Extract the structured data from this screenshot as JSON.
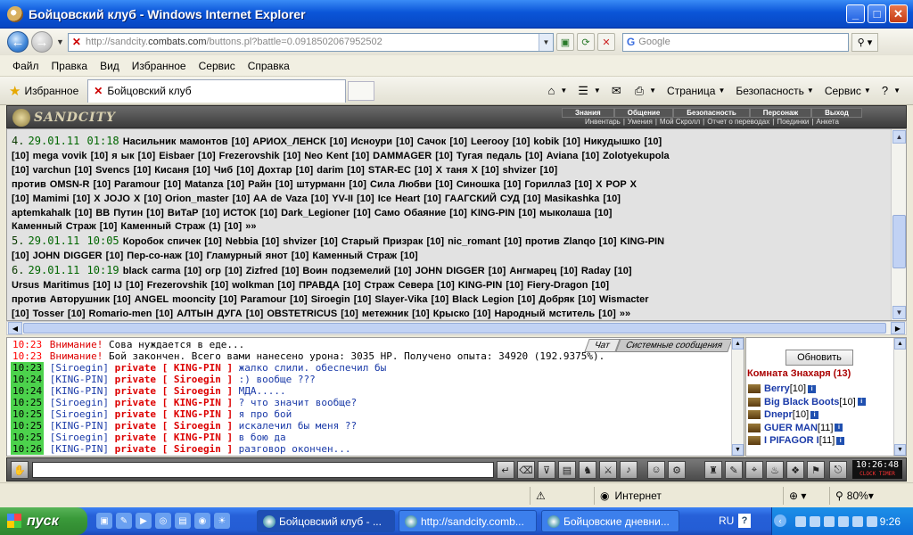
{
  "window": {
    "title": "Бойцовский клуб - Windows Internet Explorer"
  },
  "address": {
    "url_prefix": "http://sandcity.",
    "url_domain": "combats.com",
    "url_path": "/buttons.pl?battle=0.0918502067952502",
    "search_placeholder": "Google"
  },
  "menu": [
    "Файл",
    "Правка",
    "Вид",
    "Избранное",
    "Сервис",
    "Справка"
  ],
  "favbar": {
    "favorites": "Избранное",
    "tab_title": "Бойцовский клуб",
    "page": "Страница",
    "security": "Безопасность",
    "service": "Сервис"
  },
  "game": {
    "logo": "SANDCITY",
    "nav": [
      "Знания",
      "Общение",
      "Безопасность",
      "Персонаж",
      "Выход"
    ],
    "subnav": [
      "Инвентарь",
      "|",
      "Умения",
      "|",
      "Мой Скролл",
      "|",
      "Отчет о переводах",
      "|",
      "Поединки",
      "|",
      "Анкета"
    ]
  },
  "log": {
    "lines": [
      {
        "num": "4.",
        "date": "29.01.11 01:18",
        "text": "Насильник мамонтов [10] АРИОХ_ЛЕНСК [10] Исноури [10] Сачок [10] Leerooy [10] kobik [10] Никудышко [10]"
      },
      {
        "text": "[10] mega vovik [10] я ык [10] Eisbaer [10] Frezerovshik [10] Neo Kent [10] DAMMAGER [10] Тугая педаль [10] Aviana [10] Zolotyekupola"
      },
      {
        "text": "[10] varchun [10] Svencs [10] Кисаня [10] Чиб [10] Дохтар [10] darim [10] STAR-EC [10] Х таня Х [10] shvizer [10]"
      },
      {
        "text": "против OMSN-R [10] Paramour [10] Matanza [10] Райн [10] штурманн [10] Сила Любви [10] Синошка [10] Горилла3 [10] X POP X"
      },
      {
        "text": "[10] Mamimi [10] X JOJO X [10] Orion_master [10] AA de Vaza [10] YV-II [10] Ice Heart [10] ГААГСКИЙ СУД [10] Masikashka [10]"
      },
      {
        "text": "aptemkahalk [10] BB Путин [10] ВиТаР [10] ИСТОК [10] Dark_Legioner [10] Само Обаяние [10] KING-PIN [10] мыколаша [10]"
      },
      {
        "text": "Каменный Страж [10] Каменный Страж (1) [10] »»"
      },
      {
        "num": "5.",
        "date": "29.01.11 10:05",
        "text": "Коробок спичек [10] Nebbia [10] shvizer [10] Старый Призрак [10] nic_romant [10] против Zlanqo [10] KING-PIN"
      },
      {
        "text": "[10] JOHN DIGGER [10] Пер-со-наж [10] Гламурный янот [10] Каменный Страж [10]"
      },
      {
        "num": "6.",
        "date": "29.01.11 10:19",
        "text": "black carma [10] огр [10] Zizfred [10] Воин подземелий [10] JOHN DIGGER [10] Ангмарец [10] Raday [10]"
      },
      {
        "text": "Ursus Maritimus [10] IJ [10] Frezerovshik [10] wolkman [10] ПРАВДА [10] Страж Севера [10] KING-PIN [10] Fiery-Dragon [10]"
      },
      {
        "text": "против Авторушник [10] ANGEL mooncity [10] Paramour [10] Siroegin [10] Slayer-Vika [10] Black Legion [10] Добряк [10] Wismacter"
      },
      {
        "text": "[10] Tosser [10] Romario-men [10] АЛТЫН ДУГА [10] OBSTETRICUS [10] метежник [10] Крыско [10] Народный мститель [10] »»"
      }
    ]
  },
  "chat": {
    "tabs": [
      "Чат",
      "Системные сообщения"
    ],
    "lines": [
      {
        "time": "10:23",
        "warn": "Внимание!",
        "text": " Сова нуждается в еде..."
      },
      {
        "time": "10:23",
        "warn": "Внимание!",
        "text": " Бой закончен. Всего вами нанесено урона: 3035 HP. Получено опыта: 34920 (192.9375%)."
      },
      {
        "time": "10:23",
        "from": "[Siroegin]",
        "priv": "private [ KING-PIN ]",
        "text": " жалко слили. обеспечил бы"
      },
      {
        "time": "10:24",
        "from": "[KING-PIN]",
        "priv": "private [ Siroegin ]",
        "text": " :) вообще ???"
      },
      {
        "time": "10:24",
        "from": "[KING-PIN]",
        "priv": "private [ Siroegin ]",
        "text": " МДА....."
      },
      {
        "time": "10:25",
        "from": "[Siroegin]",
        "priv": "private [ KING-PIN ]",
        "text": " ? что значит вообще?"
      },
      {
        "time": "10:25",
        "from": "[Siroegin]",
        "priv": "private [ KING-PIN ]",
        "text": " я про бой"
      },
      {
        "time": "10:25",
        "from": "[KING-PIN]",
        "priv": "private [ Siroegin ]",
        "text": " искалечил бы меня ??"
      },
      {
        "time": "10:25",
        "from": "[Siroegin]",
        "priv": "private [ KING-PIN ]",
        "text": " в бою да"
      },
      {
        "time": "10:26",
        "from": "[KING-PIN]",
        "priv": "private [ Siroegin ]",
        "text": " разговор окончен..."
      }
    ]
  },
  "room": {
    "refresh": "Обновить",
    "title": "Комната Знахаря (13)",
    "users": [
      {
        "name": "Berry",
        "level": "[10]"
      },
      {
        "name": "Big Black Boots",
        "level": "[10]"
      },
      {
        "name": "Dnepr",
        "level": "[10]"
      },
      {
        "name": "GUER MAN",
        "level": "[11]"
      },
      {
        "name": "I PIFAGOR I",
        "level": "[11]"
      }
    ]
  },
  "clock": {
    "time": "10:26:48",
    "label": "CLOCK TIMER"
  },
  "status": {
    "zone": "Интернет",
    "zoom": "80%"
  },
  "taskbar": {
    "start": "пуск",
    "tasks": [
      "Бойцовский клуб - ...",
      "http://sandcity.comb...",
      "Бойцовские дневни..."
    ],
    "lang": "RU",
    "time": "9:26"
  }
}
